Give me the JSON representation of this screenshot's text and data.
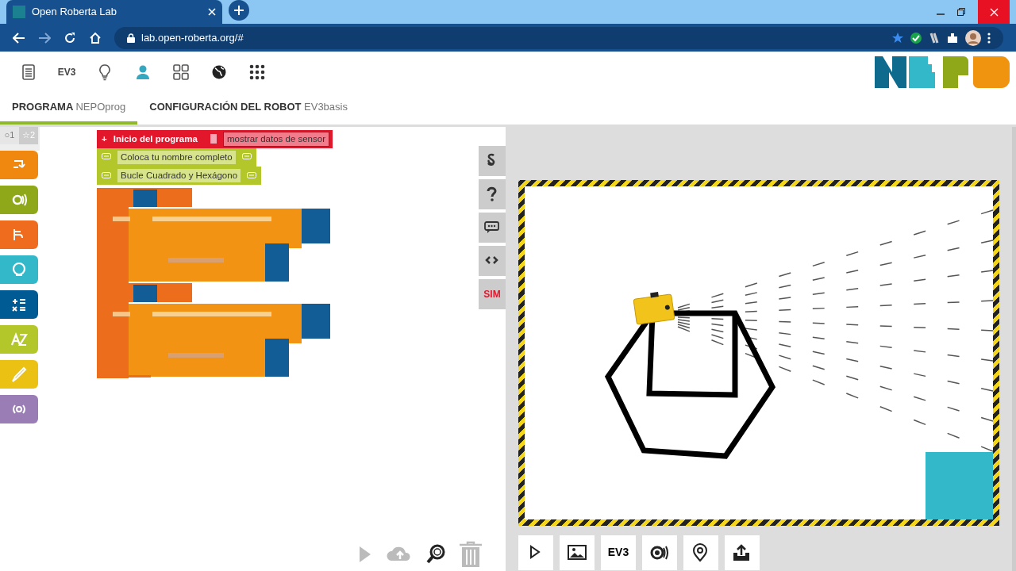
{
  "browser": {
    "tab_title": "Open Roberta Lab",
    "url": "lab.open-roberta.org/#"
  },
  "toolbar": [
    {
      "kind": "doc"
    },
    {
      "kind": "text",
      "label": "EV3"
    },
    {
      "kind": "bulb"
    },
    {
      "kind": "user"
    },
    {
      "kind": "grid"
    },
    {
      "kind": "globe"
    },
    {
      "kind": "apps"
    }
  ],
  "tabs": [
    {
      "label": "PROGRAMA",
      "name": "NEPOprog",
      "selected": true
    },
    {
      "label": "CONFIGURACIÓN DEL ROBOT",
      "name": "EV3basis",
      "selected": false
    }
  ],
  "levels": [
    {
      "label": "○1",
      "selected": true
    },
    {
      "label": "☆2",
      "selected": false
    }
  ],
  "palette": [
    {
      "kind": "action",
      "color": "#f0870f"
    },
    {
      "kind": "sensor",
      "color": "#8fa81a"
    },
    {
      "kind": "control",
      "color": "#ef6c1f"
    },
    {
      "kind": "logic",
      "color": "#33b8ca"
    },
    {
      "kind": "math",
      "color": "#005a94"
    },
    {
      "kind": "text",
      "color": "#b3c72a"
    },
    {
      "kind": "colour",
      "color": "#ebc113"
    },
    {
      "kind": "comm",
      "color": "#9a7db5"
    }
  ],
  "program": {
    "start_icon": "+",
    "start": "Inicio del programa",
    "sensor_checked": false,
    "sensor_option": "mostrar datos de sensor",
    "comments": [
      "Coloca tu nombre completo",
      "Bucle Cuadrado y Hexágono"
    ]
  },
  "side_tools": [
    {
      "kind": "section"
    },
    {
      "kind": "help"
    },
    {
      "kind": "comment"
    },
    {
      "kind": "code"
    },
    {
      "kind": "text",
      "label": "SIM"
    }
  ],
  "workspace_tools": [
    {
      "kind": "play"
    },
    {
      "kind": "cloud"
    },
    {
      "kind": "zoom"
    },
    {
      "kind": "trash"
    }
  ],
  "sim_controls": [
    {
      "kind": "play"
    },
    {
      "kind": "image"
    },
    {
      "kind": "text",
      "label": "EV3"
    },
    {
      "kind": "sensor"
    },
    {
      "kind": "pin"
    },
    {
      "kind": "export"
    }
  ]
}
